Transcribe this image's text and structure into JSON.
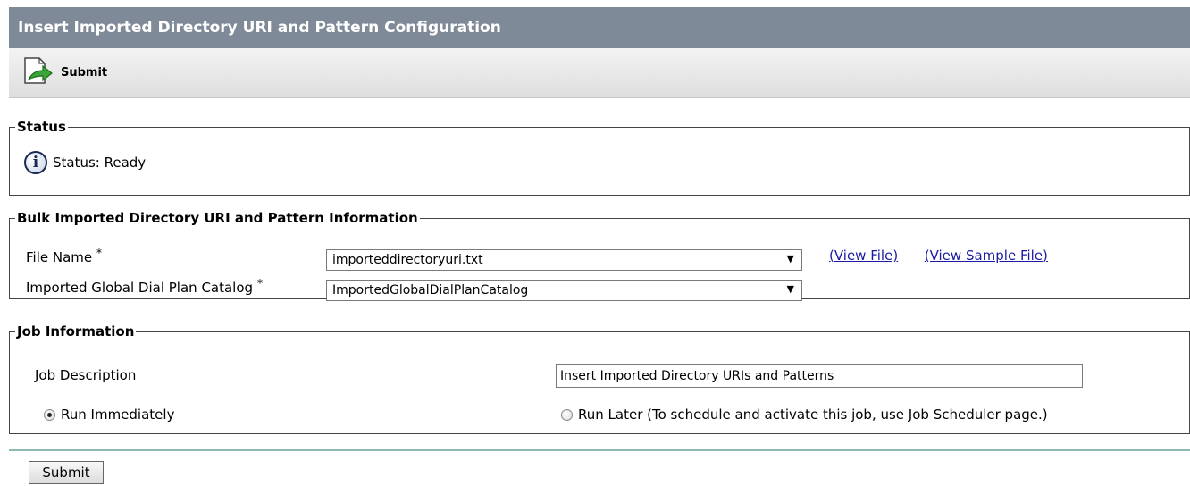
{
  "page": {
    "title": "Insert Imported Directory URI and Pattern Configuration"
  },
  "toolbar": {
    "submit_label": "Submit",
    "submit_icon": "arrow-right-page-icon"
  },
  "status": {
    "legend": "Status",
    "icon": "info-icon",
    "text": "Status: Ready"
  },
  "bulk": {
    "legend": "Bulk Imported Directory URI and Pattern Information",
    "file_name_label": "File Name",
    "file_name_required": "*",
    "file_name_value": "importeddirectoryuri.txt",
    "view_file_link": "(View File)",
    "view_sample_link": "(View Sample File)",
    "catalog_label": "Imported Global Dial Plan Catalog",
    "catalog_required": "*",
    "catalog_value": "ImportedGlobalDialPlanCatalog",
    "dropdown_arrow": "▼"
  },
  "job": {
    "legend": "Job Information",
    "description_label": "Job Description",
    "description_value": "Insert Imported Directory URIs and Patterns",
    "run_immediately_label": "Run Immediately",
    "run_immediately_checked": true,
    "run_later_label": "Run Later (To schedule and activate this job, use Job Scheduler page.)",
    "run_later_checked": false
  },
  "footer": {
    "submit_label": "Submit"
  },
  "colors": {
    "title_bar": "#7f8a98",
    "link": "#1a1aa6",
    "divider": "#8fb8b0"
  }
}
